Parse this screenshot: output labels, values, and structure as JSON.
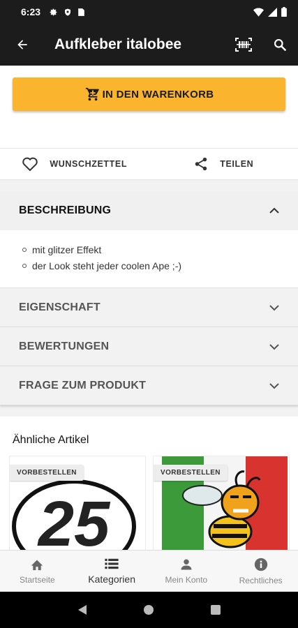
{
  "status": {
    "time": "6:23"
  },
  "appbar": {
    "title": "Aufkleber italobee"
  },
  "cart": {
    "label": "IN DEN WARENKORB"
  },
  "actions": {
    "wishlist": "WUNSCHZETTEL",
    "share": "TEILEN"
  },
  "description": {
    "header": "BESCHREIBUNG",
    "items": [
      "mit glitzer Effekt",
      "der Look steht jeder coolen Ape ;-)"
    ]
  },
  "sections": [
    "EIGENSCHAFT",
    "BEWERTUNGEN",
    "FRAGE ZUM PRODUKT"
  ],
  "similar": {
    "title": "Ähnliche Artikel",
    "cards": [
      {
        "badge": "VORBESTELLEN",
        "graphic_text": "25"
      },
      {
        "badge": "VORBESTELLEN"
      }
    ]
  },
  "bottom_nav": [
    {
      "label": "Startseite",
      "icon": "home-icon"
    },
    {
      "label": "Kategorien",
      "icon": "list-icon"
    },
    {
      "label": "Mein Konto",
      "icon": "person-icon"
    },
    {
      "label": "Rechtliches",
      "icon": "info-icon"
    }
  ],
  "colors": {
    "appbar": "#1c1c1c",
    "accent": "#fbb42d"
  }
}
